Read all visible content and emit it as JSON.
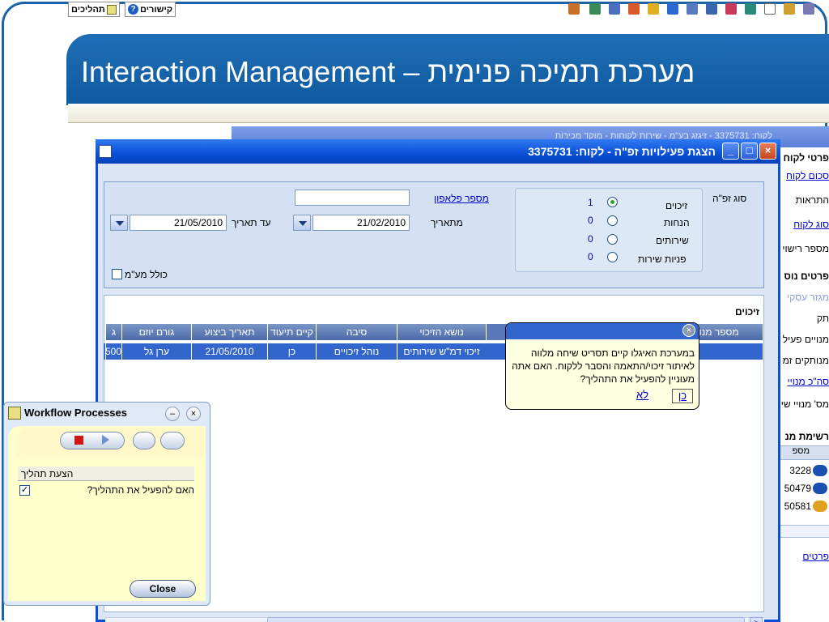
{
  "slide": {
    "title": "Interaction Management – מערכת תמיכה פנימית"
  },
  "toolbar": {
    "processes_label": "תהליכים",
    "links_label": "קישורים"
  },
  "background_window": {
    "title_fragment": "לקוח: 3375731 - זיגזג בע\"מ - שירות לקוחות - מוקד מכירות"
  },
  "dialog": {
    "title": "הצגת פעילויות זפ\"ה - לקוח: 3375731",
    "type_label": "סוג זפ\"ה",
    "types": [
      {
        "label": "זיכוים",
        "count": "1",
        "selected": true
      },
      {
        "label": "הנחות",
        "count": "0",
        "selected": false
      },
      {
        "label": "שירותים",
        "count": "0",
        "selected": false
      },
      {
        "label": "פניות שירות",
        "count": "0",
        "selected": false
      }
    ],
    "phone_label": "מספר פלאפון",
    "phone_value": "",
    "from_date_label": "מתאריך",
    "from_date": "21/02/2010",
    "to_date_label": "עד תאריך",
    "to_date": "21/05/2010",
    "include_vat_label": "כולל מע\"מ"
  },
  "grid": {
    "section_title": "זיכוים",
    "columns": [
      "מספר מנוי",
      "נושא הזיכוי",
      "סיבה",
      "קיים תיעוד",
      "תאריך ביצוע",
      "גורם יוזם",
      "ג"
    ],
    "row": {
      "subscriber": "",
      "subject": "זיכוי דמ\"ש שירותים",
      "reason": "נוהל זיכויים",
      "documented": "כן",
      "date": "21/05/2010",
      "initiator": "ערן גל",
      "amount": "500"
    }
  },
  "popup": {
    "text": "במערכת האיגלו קיים תסריט שיחה מלווה לאיתור זיכוי/התאמה והסבר ללקוח. האם אתה מעוניין להפעיל את התהליך?",
    "no_label": "לא",
    "yes_label": "כן"
  },
  "right_panel": {
    "customer_details": "פרטי לקוח",
    "link1": "סכום לקוח",
    "alerts": "התראות",
    "link2": "סוג לקוח",
    "license_no": "מספר רישוי",
    "more_details": "פרטים נוס",
    "business": "מגזר עסקי",
    "status": "תק",
    "active_subs": "מנויים פעיל",
    "disconnected_subs": "מנותקים זמ",
    "total_subs": "סה\"כ מנויי",
    "sub_count": "מס' מנויי שי",
    "subs_list": "רשימת מנ",
    "list_col": "מספ",
    "list_rows": [
      "3228",
      "50479",
      "50581"
    ],
    "details_link": "פרטים"
  },
  "workflow": {
    "title": "Workflow Processes",
    "list_header": "הצעת תהליך",
    "item": "האם להפעיל את התהליך?",
    "close_label": "Close"
  },
  "colors": {
    "title_blue": "#1f6eb5",
    "dialog_blue": "#0a4fd6",
    "grid_highlight": "#3366cc"
  }
}
